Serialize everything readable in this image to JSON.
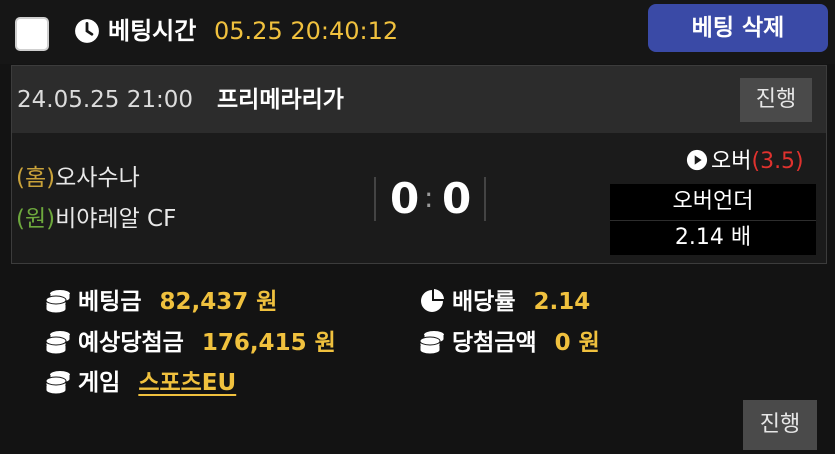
{
  "header": {
    "bet_time_label": "베팅시간",
    "bet_time_value": "05.25 20:40:12",
    "delete_button": "베팅 삭제",
    "icons": [
      "checkbox",
      "clock-icon"
    ]
  },
  "match": {
    "datetime": "24.05.25 21:00",
    "league": "프리메라리가",
    "status": "진행",
    "home_tag": "(홈)",
    "home_team": "오사수나",
    "away_tag": "(원)",
    "away_team": "비야레알 CF",
    "score_home": "0",
    "score_separator": ":",
    "score_away": "0",
    "pick_label": "오버",
    "pick_line": "(3.5)",
    "option_name": "오버언더",
    "option_odds": "2.14 배"
  },
  "summary": {
    "bet_amount_label": "베팅금",
    "bet_amount_value": "82,437 원",
    "odds_label": "배당률",
    "odds_value": "2.14",
    "expected_win_label": "예상당첨금",
    "expected_win_value": "176,415 원",
    "win_amount_label": "당첨금액",
    "win_amount_value": "0 원",
    "game_label": "게임",
    "game_value": "스포츠EU",
    "status": "진행"
  },
  "colors": {
    "accent_gold": "#f0c13e",
    "delete_button_bg": "#3a4aa6",
    "home_tag": "#c9a23a",
    "away_tag": "#6da83d",
    "over_line_red": "#e0322e",
    "background": "#131313"
  }
}
